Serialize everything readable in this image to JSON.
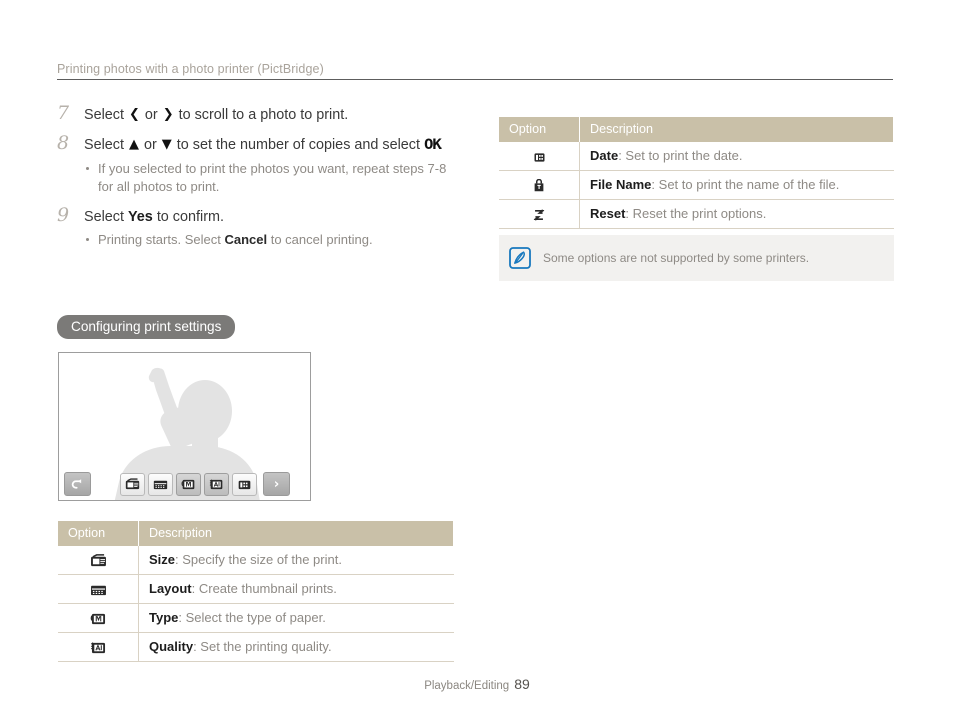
{
  "running_head": "Printing photos with a photo printer (PictBridge)",
  "steps": [
    {
      "number": "7",
      "text_before": "Select",
      "glyph_a": "left-arrow",
      "mid": "or",
      "glyph_b": "right-arrow",
      "text_after": "to scroll to a photo to print."
    },
    {
      "number": "8",
      "text_before": "Select",
      "glyph_a": "up-arrow",
      "mid": "or",
      "glyph_b": "down-arrow",
      "text_after": "to set the number of copies and select",
      "ok_label": "OK",
      "ok_period": ".",
      "bullets": [
        "If you selected to print the photos you want, repeat steps 7-8 for all photos to print."
      ]
    },
    {
      "number": "9",
      "text_before": "Select",
      "bold_word": "Yes",
      "text_after": "to confirm.",
      "bullets_rich": [
        {
          "pre": "Printing starts. Select ",
          "bold": "Cancel",
          "post": " to cancel printing."
        }
      ]
    }
  ],
  "section_heading": "Configuring print settings",
  "screen": {
    "back_button": "back-arrow",
    "next_button": "›",
    "buttons": [
      "size-icon",
      "layout-icon",
      "type-icon",
      "quality-icon",
      "date-icon"
    ]
  },
  "table_left": {
    "headers": [
      "Option",
      "Description"
    ],
    "rows": [
      {
        "icon": "size-icon",
        "term": "Size",
        "desc": ": Specify the size of the print."
      },
      {
        "icon": "layout-icon",
        "term": "Layout",
        "desc": ": Create thumbnail prints."
      },
      {
        "icon": "type-icon",
        "term": "Type",
        "desc": ": Select the type of paper."
      },
      {
        "icon": "quality-icon",
        "term": "Quality",
        "desc": ": Set the printing quality."
      }
    ]
  },
  "table_right": {
    "headers": [
      "Option",
      "Description"
    ],
    "rows": [
      {
        "icon": "date-icon",
        "term": "Date",
        "desc": ": Set to print the date."
      },
      {
        "icon": "filename-icon",
        "term": "File Name",
        "desc": ": Set to print the name of the file."
      },
      {
        "icon": "reset-icon",
        "term": "Reset",
        "desc": ": Reset the print options."
      }
    ]
  },
  "note": {
    "icon": "note-pen-icon",
    "text": "Some options are not supported by some printers."
  },
  "footer": {
    "label": "Playback/Editing",
    "page": "89"
  },
  "colors": {
    "table_header": "#c9c0a8",
    "pill": "#7b7a78",
    "note_bg": "#f2f1ef",
    "note_icon": "#1878be",
    "body_text": "#3a3a3a",
    "muted_text": "#8e8a85"
  }
}
